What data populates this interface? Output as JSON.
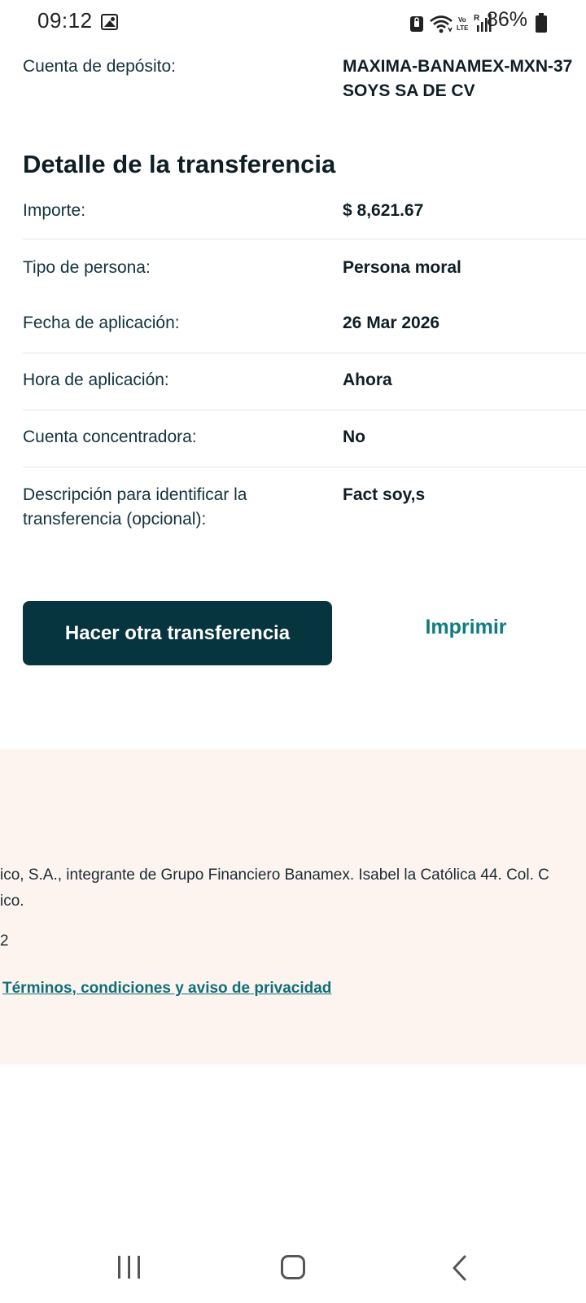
{
  "status_bar": {
    "time": "09:12",
    "battery_percent": "86%",
    "icons": [
      "photo-icon",
      "privacy-lock-icon",
      "wifi-icon",
      "volte-icon",
      "signal-icon",
      "battery-icon"
    ]
  },
  "deposit": {
    "label": "Cuenta de depósito:",
    "value_line1": "MAXIMA-BANAMEX-MXN-37",
    "value_line2": "SOYS SA DE CV"
  },
  "transfer_detail": {
    "title": "Detalle de la transferencia",
    "rows": [
      {
        "label": "Importe:",
        "value": "$ 8,621.67"
      },
      {
        "label": "Tipo de persona:",
        "value": "Persona moral"
      },
      {
        "label": "Fecha de aplicación:",
        "value": "26 Mar 2026"
      },
      {
        "label": "Hora de aplicación:",
        "value": "Ahora"
      },
      {
        "label": "Cuenta concentradora:",
        "value": "No"
      },
      {
        "label_line1": "Descripción para identificar la",
        "label_line2": "transferencia (opcional):",
        "value": "Fact soy,s"
      }
    ]
  },
  "actions": {
    "primary_label": "Hacer otra transferencia",
    "secondary_label": "Imprimir"
  },
  "footer": {
    "line1": "ico, S.A., integrante de Grupo Financiero Banamex. Isabel la Católica 44. Col. C",
    "line2": "ico.",
    "line3": "2",
    "link": "Términos, condiciones y aviso de privacidad"
  },
  "colors": {
    "primary_button": "#06343f",
    "link": "#0f7c80",
    "footer_bg": "#fdf4f0",
    "text": "#13323d"
  }
}
